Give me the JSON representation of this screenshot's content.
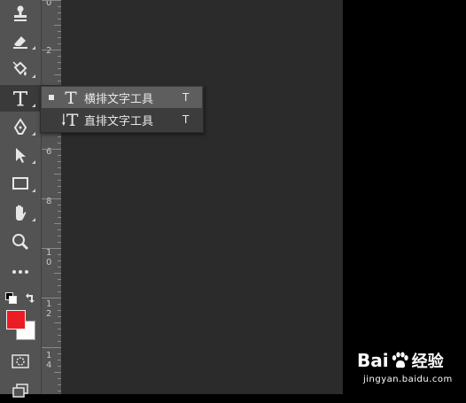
{
  "app": "photoshop",
  "ruler": {
    "numbers": [
      "0",
      "2",
      "4",
      "6",
      "8",
      "1\n0",
      "1\n2",
      "1\n4"
    ]
  },
  "toolbar": {
    "tools": [
      {
        "name": "stamp-tool",
        "icon": "stamp-icon"
      },
      {
        "name": "eraser-tool",
        "icon": "eraser-icon"
      },
      {
        "name": "paint-bucket-tool",
        "icon": "paint-bucket-icon"
      },
      {
        "name": "type-tool",
        "icon": "type-icon",
        "active": true
      },
      {
        "name": "pen-tool",
        "icon": "pen-icon"
      },
      {
        "name": "selection-tool",
        "icon": "arrow-icon"
      },
      {
        "name": "rectangle-tool",
        "icon": "rectangle-icon"
      },
      {
        "name": "hand-tool",
        "icon": "hand-icon"
      },
      {
        "name": "zoom-tool",
        "icon": "magnifier-icon"
      },
      {
        "name": "more-tools",
        "icon": "ellipsis-icon"
      }
    ],
    "foreground_color": "#ec1c24",
    "background_color": "#ffffff"
  },
  "flyout": {
    "items": [
      {
        "label": "横排文字工具",
        "shortcut": "T",
        "selected": true
      },
      {
        "label": "直排文字工具",
        "shortcut": "T",
        "selected": false
      }
    ]
  },
  "watermark": {
    "brand_latin": "Bai",
    "brand_cn": "经验",
    "url": "jingyan.baidu.com"
  },
  "colors": {
    "toolbar_bg": "#535353",
    "canvas_bg": "#2b2b2b",
    "flyout_bg": "#3c3c3c",
    "flyout_selected": "#5e5e5e"
  }
}
